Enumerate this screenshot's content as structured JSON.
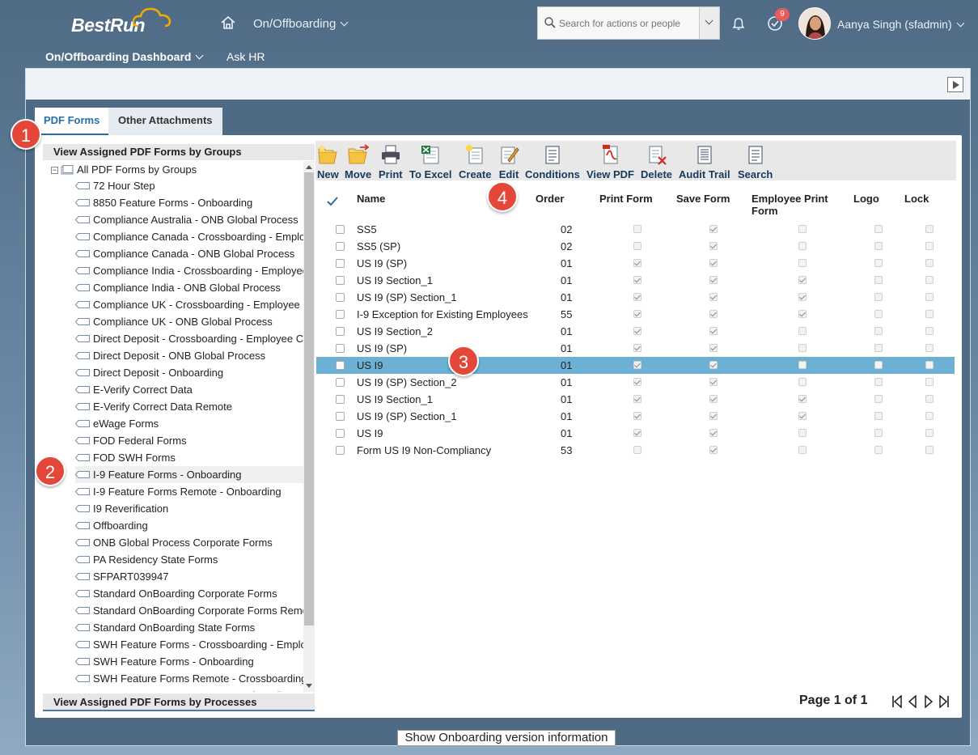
{
  "header": {
    "logo": "BestRun",
    "module": "On/Offboarding",
    "search_placeholder": "Search for actions or people",
    "notification_count": "9",
    "user_name": "Aanya Singh (sfadmin)"
  },
  "subnav": {
    "dashboard": "On/Offboarding Dashboard",
    "ask_hr": "Ask HR"
  },
  "tabs": [
    "PDF Forms",
    "Other Attachments"
  ],
  "left_panel": {
    "title": "View Assigned PDF Forms by Groups",
    "root": "All PDF Forms by Groups",
    "footer": "View Assigned PDF Forms by Processes",
    "items": [
      "72 Hour Step",
      "8850 Feature Forms - Onboarding",
      "Compliance Australia - ONB Global Process",
      "Compliance Canada - Crossboarding - Employee",
      "Compliance Canada - ONB Global Process",
      "Compliance India - Crossboarding - Employee",
      "Compliance India - ONB Global Process",
      "Compliance UK - Crossboarding - Employee",
      "Compliance UK - ONB Global Process",
      "Direct Deposit - Crossboarding - Employee C",
      "Direct Deposit - ONB Global Process",
      "Direct Deposit - Onboarding",
      "E-Verify Correct Data",
      "E-Verify Correct Data Remote",
      "eWage Forms",
      "FOD Federal Forms",
      "FOD SWH Forms",
      "I-9 Feature Forms - Onboarding",
      "I-9 Feature Forms Remote - Onboarding",
      "I9 Reverification",
      "Offboarding",
      "ONB Global Process Corporate Forms",
      "PA Residency State Forms",
      "SFPART039947",
      "Standard OnBoarding Corporate Forms",
      "Standard OnBoarding Corporate Forms Remote",
      "Standard OnBoarding State Forms",
      "SWH Feature Forms - Crossboarding - Employee",
      "SWH Feature Forms - Onboarding",
      "SWH Feature Forms Remote - Crossboarding",
      "SWH Feature Forms Remote - Onboarding"
    ],
    "selected_index": 17
  },
  "toolbar": [
    "New",
    "Move",
    "Print",
    "To Excel",
    "Create",
    "Edit",
    "Conditions",
    "View PDF",
    "Delete",
    "Audit Trail",
    "Search"
  ],
  "table": {
    "columns": [
      "Name",
      "Order",
      "Print Form",
      "Save Form",
      "Employee Print Form",
      "Logo",
      "Lock"
    ],
    "rows": [
      {
        "name": "SS5",
        "order": "02",
        "print": false,
        "save": true,
        "emp": false,
        "logo": false,
        "lock": false
      },
      {
        "name": "SS5 (SP)",
        "order": "02",
        "print": false,
        "save": true,
        "emp": false,
        "logo": false,
        "lock": false
      },
      {
        "name": "US I9 (SP)",
        "order": "01",
        "print": true,
        "save": true,
        "emp": false,
        "logo": false,
        "lock": false
      },
      {
        "name": "US I9 Section_1",
        "order": "01",
        "print": true,
        "save": true,
        "emp": true,
        "logo": false,
        "lock": false
      },
      {
        "name": "US I9 (SP) Section_1",
        "order": "01",
        "print": true,
        "save": true,
        "emp": true,
        "logo": false,
        "lock": false
      },
      {
        "name": "I-9 Exception for Existing Employees",
        "order": "55",
        "print": true,
        "save": true,
        "emp": true,
        "logo": false,
        "lock": false
      },
      {
        "name": "US I9 Section_2",
        "order": "01",
        "print": true,
        "save": true,
        "emp": false,
        "logo": false,
        "lock": false
      },
      {
        "name": "US I9 (SP)",
        "order": "01",
        "print": true,
        "save": true,
        "emp": false,
        "logo": false,
        "lock": false
      },
      {
        "name": "US I9",
        "order": "01",
        "print": true,
        "save": true,
        "emp": false,
        "logo": false,
        "lock": false
      },
      {
        "name": "US I9 (SP) Section_2",
        "order": "01",
        "print": true,
        "save": true,
        "emp": false,
        "logo": false,
        "lock": false
      },
      {
        "name": "US I9 Section_1",
        "order": "01",
        "print": true,
        "save": true,
        "emp": true,
        "logo": false,
        "lock": false
      },
      {
        "name": "US I9 (SP) Section_1",
        "order": "01",
        "print": true,
        "save": true,
        "emp": true,
        "logo": false,
        "lock": false
      },
      {
        "name": "US I9",
        "order": "01",
        "print": true,
        "save": true,
        "emp": false,
        "logo": false,
        "lock": false
      },
      {
        "name": "Form US I9 Non-Compliancy",
        "order": "53",
        "print": false,
        "save": true,
        "emp": false,
        "logo": false,
        "lock": false
      }
    ],
    "selected_row": 8
  },
  "pager": {
    "text": "Page 1 of 1"
  },
  "footer_link": "Show Onboarding version information",
  "callouts": [
    "1",
    "2",
    "3",
    "4"
  ],
  "colors": {
    "accent": "#2a6ea6",
    "selected_row": "#6cb0d3",
    "callout": "#e2473a"
  }
}
